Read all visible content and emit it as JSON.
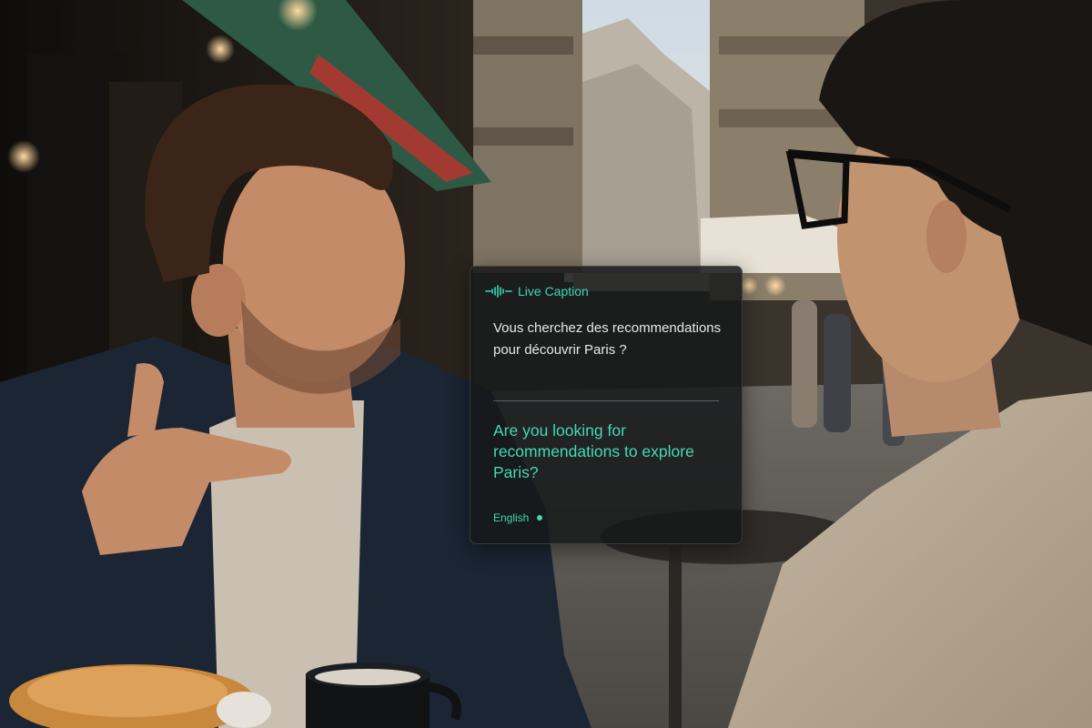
{
  "caption": {
    "title": "Live Caption",
    "icon": "waveform-icon",
    "source_text": "Vous cherchez des recommendations pour découvrir Paris ?",
    "translation_text": "Are you looking for recommendations to explore Paris?",
    "language": "English",
    "accent_color": "#3fd9b4"
  }
}
